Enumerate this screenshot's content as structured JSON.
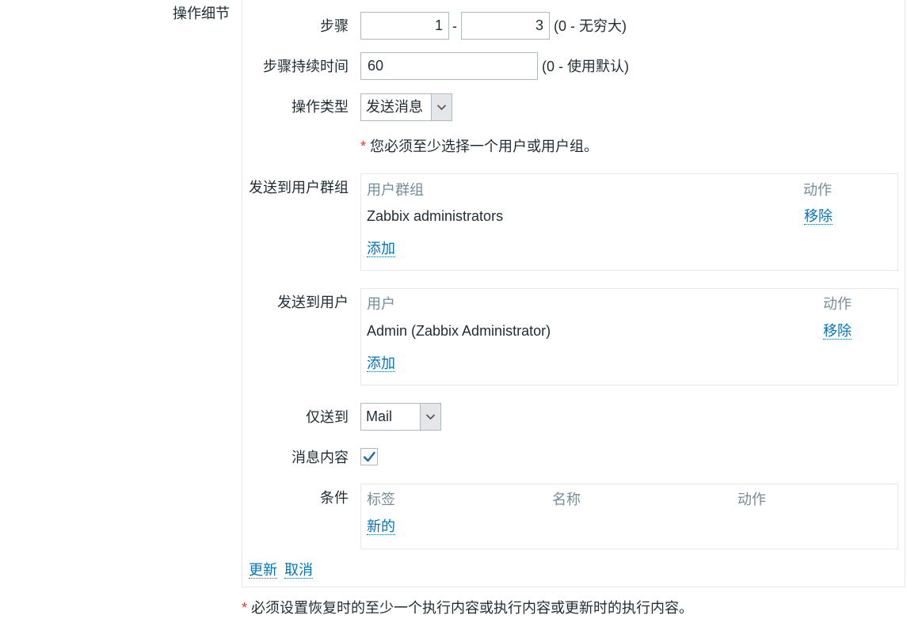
{
  "section_label": "操作细节",
  "steps": {
    "label": "步骤",
    "from": "1",
    "separator": "-",
    "to": "3",
    "hint": "(0 - 无穷大)"
  },
  "step_duration": {
    "label": "步骤持续时间",
    "value": "60",
    "hint": "(0 - 使用默认)"
  },
  "operation_type": {
    "label": "操作类型",
    "selected": "发送消息"
  },
  "required_notice": {
    "asterisk": "*",
    "text": "您必须至少选择一个用户或用户组。"
  },
  "user_groups": {
    "label": "发送到用户群组",
    "col_name": "用户群组",
    "col_action": "动作",
    "rows": [
      {
        "name": "Zabbix administrators",
        "action": "移除"
      }
    ],
    "add_label": "添加"
  },
  "users": {
    "label": "发送到用户",
    "col_name": "用户",
    "col_action": "动作",
    "rows": [
      {
        "name": "Admin (Zabbix Administrator)",
        "action": "移除"
      }
    ],
    "add_label": "添加"
  },
  "send_only_to": {
    "label": "仅送到",
    "selected": "Mail"
  },
  "custom_message": {
    "label": "消息内容",
    "checked": true
  },
  "conditions": {
    "label": "条件",
    "col_label": "标签",
    "col_name": "名称",
    "col_action": "动作",
    "new_label": "新的"
  },
  "form_actions": {
    "update": "更新",
    "cancel": "取消"
  },
  "footnote": {
    "asterisk": "*",
    "text": "必须设置恢复时的至少一个执行内容或执行内容或更新时的执行内容。"
  },
  "icons": {
    "select_arrow": "chevron-down-icon",
    "checkbox_mark": "checkmark-icon"
  },
  "colors": {
    "link": "#0275b8",
    "header": "#768d99",
    "required": "#e33734",
    "text": "#1f2c33",
    "check": "#1a6aa4"
  }
}
